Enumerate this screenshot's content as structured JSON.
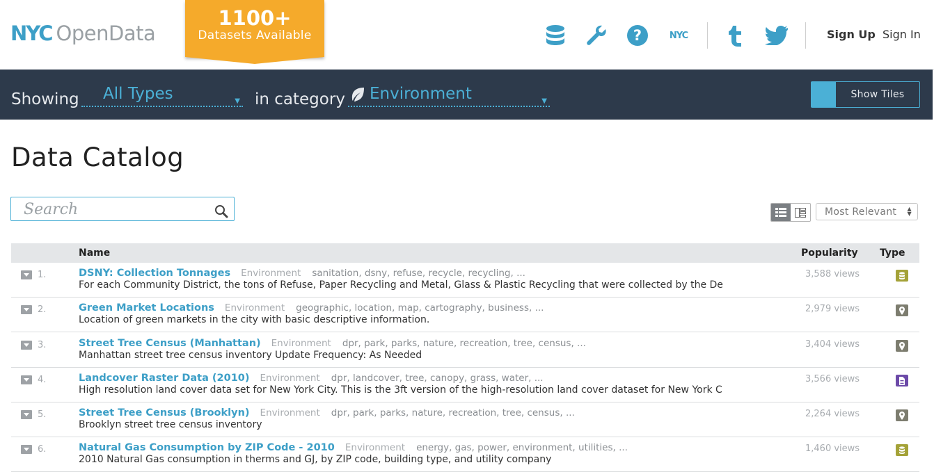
{
  "header": {
    "logo_nyc": "NYC",
    "logo_opendata": "OpenData",
    "banner_count": "1100+",
    "banner_sub": "Datasets Available",
    "nav_icons": [
      "database-icon",
      "wrench-icon",
      "help-icon",
      "nyc-icon",
      "tumblr-icon",
      "twitter-icon"
    ],
    "nyc_small": "NYC",
    "sign_up": "Sign Up",
    "sign_in": "Sign In"
  },
  "filter": {
    "showing_label": "Showing",
    "type_value": "All Types",
    "category_label": "in category",
    "category_value": "Environment",
    "show_tiles": "Show Tiles"
  },
  "main": {
    "title": "Data Catalog",
    "search_placeholder": "Search",
    "sort_value": "Most Relevant"
  },
  "table": {
    "columns": {
      "name": "Name",
      "popularity": "Popularity",
      "type": "Type"
    },
    "rows": [
      {
        "num": "1.",
        "title": "DSNY: Collection Tonnages",
        "category": "Environment",
        "tags": "sanitation, dsny, refuse, recycle, recycling, ...",
        "desc": "For each Community District, the tons of Refuse, Paper Recycling and Metal, Glass & Plastic Recycling that were collected by the De",
        "views": "3,588 views",
        "type": "data"
      },
      {
        "num": "2.",
        "title": "Green Market Locations",
        "category": "Environment",
        "tags": "geographic, location, map, cartography, business, ...",
        "desc": "Location of green markets in the city with basic descriptive information.",
        "views": "2,979 views",
        "type": "map"
      },
      {
        "num": "3.",
        "title": "Street Tree Census (Manhattan)",
        "category": "Environment",
        "tags": "dpr, park, parks, nature, recreation, tree, census, ...",
        "desc": "Manhattan street tree census inventory Update Frequency: As Needed",
        "views": "3,404 views",
        "type": "map"
      },
      {
        "num": "4.",
        "title": "Landcover Raster Data (2010)",
        "category": "Environment",
        "tags": "dpr, landcover, tree, canopy, grass, water, ...",
        "desc": "High resolution land cover data set for New York City. This is the 3ft version of the high-resolution land cover dataset for New York C",
        "views": "3,566 views",
        "type": "file"
      },
      {
        "num": "5.",
        "title": "Street Tree Census (Brooklyn)",
        "category": "Environment",
        "tags": "dpr, park, parks, nature, recreation, tree, census, ...",
        "desc": "Brooklyn street tree census inventory",
        "views": "2,264 views",
        "type": "map"
      },
      {
        "num": "6.",
        "title": "Natural Gas Consumption by ZIP Code - 2010",
        "category": "Environment",
        "tags": "energy, gas, power, environment, utilities, ...",
        "desc": "2010 Natural Gas consumption in therms and GJ, by ZIP code, building type, and utility company",
        "views": "1,460 views",
        "type": "data"
      }
    ]
  },
  "colors": {
    "accent": "#3d9fc7",
    "banner": "#f5aa2b",
    "filterbar": "#2d3a4b",
    "type_data": "#a4a238",
    "type_map": "#7d7d6f",
    "type_file": "#6c4aa8"
  }
}
